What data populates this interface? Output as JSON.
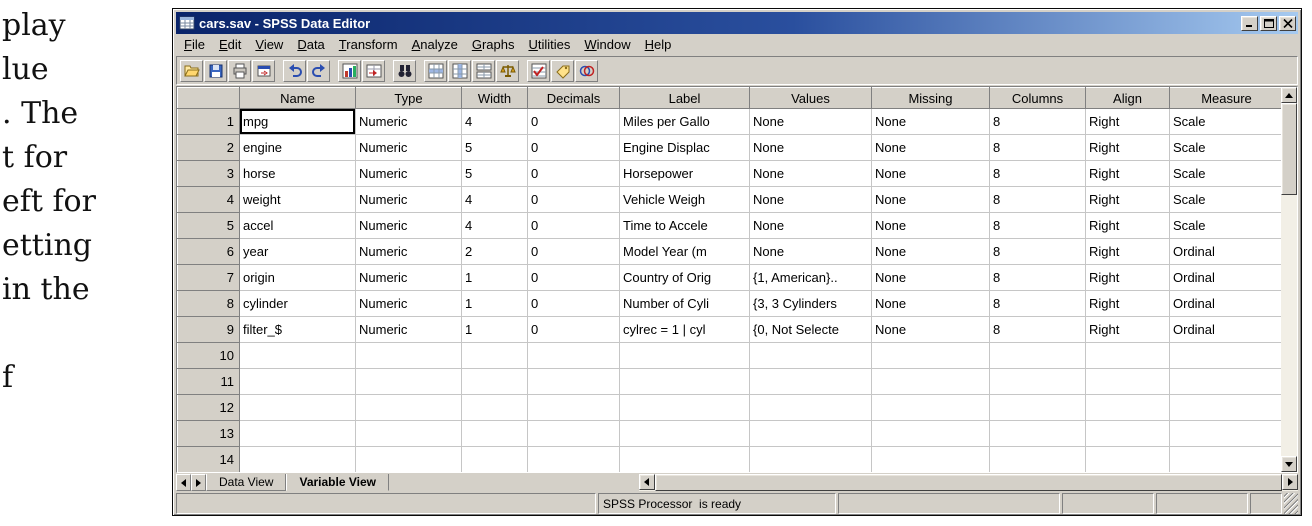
{
  "document": {
    "lines": [
      "play",
      "lue",
      ". The",
      "t for",
      "eft for",
      "etting",
      "in the",
      "",
      "f"
    ]
  },
  "window": {
    "title": "cars.sav - SPSS Data Editor",
    "menu": [
      "File",
      "Edit",
      "View",
      "Data",
      "Transform",
      "Analyze",
      "Graphs",
      "Utilities",
      "Window",
      "Help"
    ],
    "toolbar_icons": [
      "open-file-icon",
      "save-file-icon",
      "print-icon",
      "dialog-recall-icon",
      "undo-icon",
      "redo-icon",
      "goto-chart-icon",
      "goto-case-icon",
      "find-icon",
      "insert-cases-icon",
      "insert-variable-icon",
      "split-file-icon",
      "weight-cases-icon",
      "select-cases-icon",
      "value-labels-icon",
      "use-sets-icon"
    ],
    "grid": {
      "columns": [
        "Name",
        "Type",
        "Width",
        "Decimals",
        "Label",
        "Values",
        "Missing",
        "Columns",
        "Align",
        "Measure"
      ],
      "selected": {
        "row": 0,
        "col": 0
      },
      "rows": [
        {
          "n": "1",
          "cells": [
            "mpg",
            "Numeric",
            "4",
            "0",
            "Miles per Gallo",
            "None",
            "None",
            "8",
            "Right",
            "Scale"
          ]
        },
        {
          "n": "2",
          "cells": [
            "engine",
            "Numeric",
            "5",
            "0",
            "Engine Displac",
            "None",
            "None",
            "8",
            "Right",
            "Scale"
          ]
        },
        {
          "n": "3",
          "cells": [
            "horse",
            "Numeric",
            "5",
            "0",
            "Horsepower",
            "None",
            "None",
            "8",
            "Right",
            "Scale"
          ]
        },
        {
          "n": "4",
          "cells": [
            "weight",
            "Numeric",
            "4",
            "0",
            "Vehicle Weigh",
            "None",
            "None",
            "8",
            "Right",
            "Scale"
          ]
        },
        {
          "n": "5",
          "cells": [
            "accel",
            "Numeric",
            "4",
            "0",
            "Time to Accele",
            "None",
            "None",
            "8",
            "Right",
            "Scale"
          ]
        },
        {
          "n": "6",
          "cells": [
            "year",
            "Numeric",
            "2",
            "0",
            "Model Year (m",
            "None",
            "None",
            "8",
            "Right",
            "Ordinal"
          ]
        },
        {
          "n": "7",
          "cells": [
            "origin",
            "Numeric",
            "1",
            "0",
            "Country of Orig",
            "{1, American}..",
            "None",
            "8",
            "Right",
            "Ordinal"
          ]
        },
        {
          "n": "8",
          "cells": [
            "cylinder",
            "Numeric",
            "1",
            "0",
            "Number of Cyli",
            "{3, 3 Cylinders",
            "None",
            "8",
            "Right",
            "Ordinal"
          ]
        },
        {
          "n": "9",
          "cells": [
            "filter_$",
            "Numeric",
            "1",
            "0",
            "cylrec = 1 | cyl",
            "{0, Not Selecte",
            "None",
            "8",
            "Right",
            "Ordinal"
          ]
        },
        {
          "n": "10",
          "cells": [
            "",
            "",
            "",
            "",
            "",
            "",
            "",
            "",
            "",
            ""
          ]
        },
        {
          "n": "11",
          "cells": [
            "",
            "",
            "",
            "",
            "",
            "",
            "",
            "",
            "",
            ""
          ]
        },
        {
          "n": "12",
          "cells": [
            "",
            "",
            "",
            "",
            "",
            "",
            "",
            "",
            "",
            ""
          ]
        },
        {
          "n": "13",
          "cells": [
            "",
            "",
            "",
            "",
            "",
            "",
            "",
            "",
            "",
            ""
          ]
        },
        {
          "n": "14",
          "cells": [
            "",
            "",
            "",
            "",
            "",
            "",
            "",
            "",
            "",
            ""
          ]
        }
      ]
    },
    "tabs": [
      {
        "label": "Data View",
        "active": false
      },
      {
        "label": "Variable View",
        "active": true
      }
    ],
    "status": "SPSS Processor  is ready"
  }
}
